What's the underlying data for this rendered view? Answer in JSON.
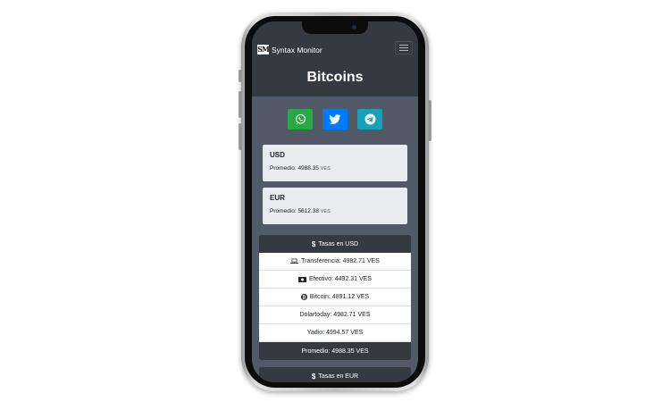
{
  "navbar": {
    "logo_text": "SM",
    "brand": "Syntax Monitor",
    "menu_icon": "hamburger-icon"
  },
  "hero": {
    "title": "Bitcoins"
  },
  "share": [
    {
      "name": "whatsapp-icon",
      "color": "#28a745"
    },
    {
      "name": "twitter-icon",
      "color": "#007bff"
    },
    {
      "name": "telegram-icon",
      "color": "#17a2b8"
    }
  ],
  "currencies": [
    {
      "code": "USD",
      "label": "Promedio:",
      "value": "4988.35",
      "unit": "VES"
    },
    {
      "code": "EUR",
      "label": "Promedio:",
      "value": "5612.38",
      "unit": "VES"
    }
  ],
  "usd_rates": {
    "header": "Tasas en USD",
    "rows": [
      {
        "icon": "laptop-icon",
        "text": "Transferencia: 4982.71 VES"
      },
      {
        "icon": "cash-icon",
        "text": "Efectivo: 4492.31 VES"
      },
      {
        "icon": "bitcoin-icon",
        "text": "Bitcoin: 4891.12 VES"
      },
      {
        "icon": "",
        "text": "Dolartoday: 4982.71 VES"
      },
      {
        "icon": "",
        "text": "Yadio: 4994.57 VES"
      }
    ],
    "footer": "Promedio: 4988.35 VES"
  },
  "eur_rates": {
    "header": "Tasas en EUR"
  },
  "colors": {
    "dark": "#343a40",
    "screen_bg": "#515a66",
    "card": "#e9ecef"
  }
}
